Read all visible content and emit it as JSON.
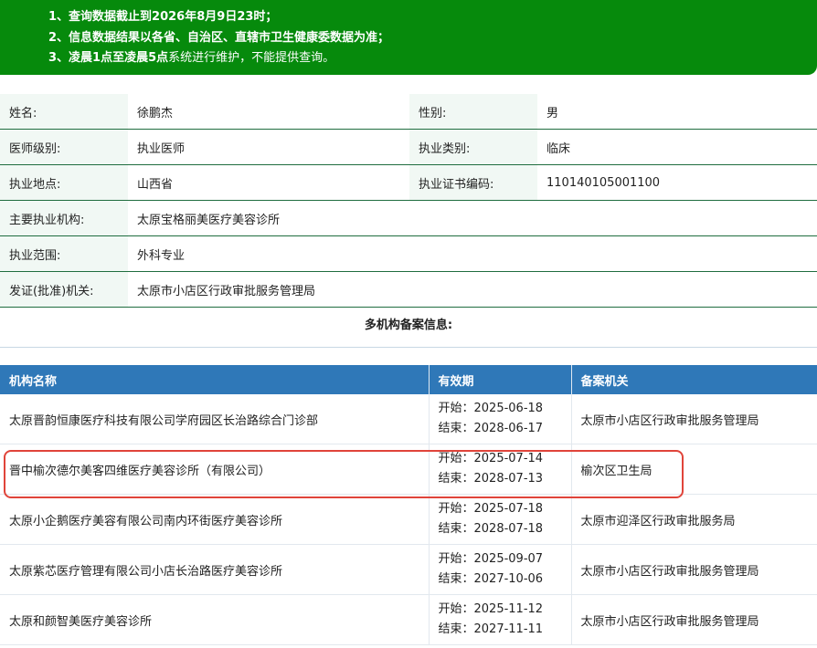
{
  "notice": {
    "line1": "1、查询数据截止到2026年8月9日23时；",
    "line2": "2、信息数据结果以各省、自治区、直辖市卫生健康委数据为准；",
    "line3_bold": "3、凌晨1点至凌晨5点",
    "line3_normal": "系统进行维护，不能提供查询。"
  },
  "info": {
    "name_label": "姓名:",
    "name": "徐鹏杰",
    "gender_label": "性别:",
    "gender": "男",
    "level_label": "医师级别:",
    "level": "执业医师",
    "category_label": "执业类别:",
    "category": "临床",
    "location_label": "执业地点:",
    "location": "山西省",
    "cert_label": "执业证书编码:",
    "cert": "110140105001100",
    "org_label": "主要执业机构:",
    "org": "太原宝格丽美医疗美容诊所",
    "scope_label": "执业范围:",
    "scope": "外科专业",
    "issuer_label": "发证(批准)机关:",
    "issuer": "太原市小店区行政审批服务管理局"
  },
  "multi_header": "多机构备案信息:",
  "orgs": {
    "headers": [
      "机构名称",
      "有效期",
      "备案机关"
    ],
    "rows": [
      {
        "name": "太原晋韵恒康医疗科技有限公司学府园区长治路综合门诊部",
        "start": "开始：2025-06-18",
        "end": "结束：2028-06-17",
        "authority": "太原市小店区行政审批服务管理局"
      },
      {
        "name": "晋中榆次德尔美客四维医疗美容诊所（有限公司）",
        "start": "开始：2025-07-14",
        "end": "结束：2028-07-13",
        "authority": "榆次区卫生局"
      },
      {
        "name": "太原小企鹅医疗美容有限公司南内环街医疗美容诊所",
        "start": "开始：2025-07-18",
        "end": "结束：2028-07-18",
        "authority": "太原市迎泽区行政审批服务局"
      },
      {
        "name": "太原紫芯医疗管理有限公司小店长治路医疗美容诊所",
        "start": "开始：2025-09-07",
        "end": "结束：2027-10-06",
        "authority": "太原市小店区行政审批服务管理局"
      },
      {
        "name": "太原和颜智美医疗美容诊所",
        "start": "开始：2025-11-12",
        "end": "结束：2027-11-11",
        "authority": "太原市小店区行政审批服务管理局"
      }
    ]
  }
}
